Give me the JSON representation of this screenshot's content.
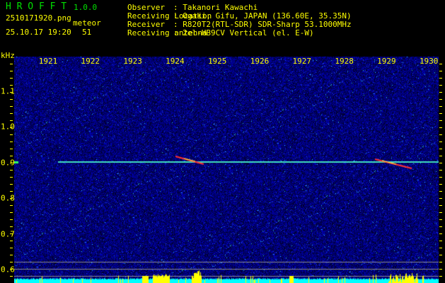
{
  "app": {
    "title": "H R O F F T",
    "version": "1.0.0"
  },
  "file": {
    "name": "2510171920.png",
    "datetime": "25.10.17 19:20"
  },
  "meteor": {
    "label": "meteor",
    "count": "51"
  },
  "info": [
    {
      "label": "Observer",
      "value": ": Takanori Kawachi"
    },
    {
      "label": "Receiving Location",
      "value": ": Ogaki, Gifu, JAPAN (136.60E, 35.35N)"
    },
    {
      "label": "Receiver",
      "value": ": R820T2(RTL-SDR) SDR-Sharp 53.1000MHz"
    },
    {
      "label": "Receiving antenna",
      "value": ": 2el-HB9CV Vertical (el. E-W)"
    }
  ],
  "axis": {
    "y_unit": "kHz",
    "y_ticks": [
      "1.1",
      "1.0",
      "0.9",
      "0.8",
      "0.7",
      "0.6"
    ],
    "x_ticks": [
      "1921",
      "1922",
      "1923",
      "1924",
      "1925",
      "1926",
      "1927",
      "1928",
      "1929",
      "1930"
    ]
  },
  "colors": {
    "text": "#ffff00",
    "title": "#00e000",
    "background_noise": "#0a1a9a",
    "carrier": "#40e0c0",
    "meteor": "#ff3030",
    "level_bar": "#00ffff",
    "level_peak": "#ffff00"
  }
}
